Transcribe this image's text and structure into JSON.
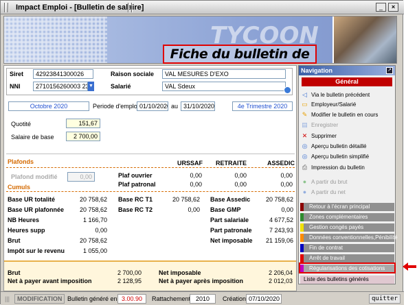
{
  "window": {
    "title": "Impact Emploi - [Bulletin de salaire]",
    "min": "_",
    "close": "×"
  },
  "banner": {
    "brand": "TYCOON",
    "heading": "Fiche du bulletin de salaire"
  },
  "form": {
    "siret_label": "Siret",
    "siret": "42923841300026",
    "raison_label": "Raison sociale",
    "raison": "VAL MESURES D'EXO",
    "nni_label": "NNI",
    "nni": "2710156260003 23",
    "salarie_label": "Salarié",
    "salarie": "VAL Sdeux"
  },
  "period": {
    "month": "Octobre 2020",
    "label": "Periode d'emploi",
    "from": "01/10/2020",
    "au": "au",
    "to": "31/10/2020",
    "quarter": "4e Trimestre  2020"
  },
  "quotite": {
    "label": "Quotité",
    "value": "151,67"
  },
  "base": {
    "label": "Salaire de base",
    "value": "2 700,00"
  },
  "plafonds": {
    "title": "Plafonds",
    "col1": "URSSAF",
    "col2": "RETRAITE",
    "col3": "ASSEDIC",
    "modif_label": "Plafond modifié",
    "modif_value": "0,00",
    "ouvrier": "Plaf ouvrier",
    "patronal": "Plaf patronal",
    "o1": "0,00",
    "o2": "0,00",
    "o3": "0,00",
    "p1": "0,00",
    "p2": "0,00",
    "p3": "0,00"
  },
  "cumuls": {
    "title": "Cumuls",
    "c1": [
      [
        "Base UR totalité",
        "20 758,62"
      ],
      [
        "Base UR plafonnée",
        "20 758,62"
      ],
      [
        "NB Heures",
        "1 166,70"
      ],
      [
        "Heures supp",
        "0,00"
      ],
      [
        "Brut",
        "20 758,62"
      ],
      [
        "Impôt sur le revenu",
        "1 055,00"
      ]
    ],
    "c2": [
      [
        "Base RC T1",
        "20 758,62"
      ],
      [
        "Base RC T2",
        "0,00"
      ]
    ],
    "c3": [
      [
        "Base Assedic",
        "20 758,62"
      ],
      [
        "Base GMP",
        "0,00"
      ],
      [
        "Part salariale",
        "4 677,52"
      ],
      [
        "Part patronale",
        "7 243,93"
      ],
      [
        "Net imposable",
        "21 159,06"
      ]
    ]
  },
  "totals": {
    "brut_label": "Brut",
    "brut": "2 700,00",
    "net_avant_label": "Net à payer avant imposition",
    "net_avant": "2 128,95",
    "netimp_label": "Net imposable",
    "netimp": "2 206,04",
    "net_apres_label": "Net à payer après imposition",
    "net_apres": "2 012,03"
  },
  "nav": {
    "title": "Navigation",
    "section": "Général",
    "items": [
      {
        "label": "Via le bulletin précédent",
        "icon": "doc-back-icon"
      },
      {
        "label": "Employeur/Salarié",
        "icon": "folder-icon"
      },
      {
        "label": "Modifier le bulletin en cours",
        "icon": "folder-edit-icon"
      },
      {
        "label": "Enregistrer",
        "icon": "save-icon"
      },
      {
        "label": "Supprimer",
        "icon": "delete-icon"
      },
      {
        "label": "Aperçu bulletin détaillé",
        "icon": "preview-icon"
      },
      {
        "label": "Aperçu bulletin simplifié",
        "icon": "preview-simple-icon"
      },
      {
        "label": "Impression du bulletin",
        "icon": "printer-icon"
      },
      {
        "label": "A partir du brut",
        "icon": "brut-icon"
      },
      {
        "label": "A partir du net",
        "icon": "net-icon"
      }
    ],
    "categories": [
      {
        "label": "Retour à l'écran principal",
        "color": "#8b0000"
      },
      {
        "label": "Zones complémentaires",
        "color": "#2e8b2e"
      },
      {
        "label": "Gestion congés payés",
        "color": "#f0e000"
      },
      {
        "label": "Données conventionnelles,Pénibilité",
        "color": "#ff8c00"
      },
      {
        "label": "Fin de contrat",
        "color": "#0000c0"
      },
      {
        "label": "Arrêt de travail",
        "color": "#e00000"
      },
      {
        "label": "Régularisations des cotisations",
        "color": "#c000c0"
      }
    ],
    "list_label": "Liste des bulletins générés"
  },
  "status": {
    "mode": "MODIFICATION",
    "gen_label": "Bulletin généré en",
    "version": "3.00.90",
    "ratt_label": "Rattachement",
    "ratt": "2010",
    "creation_label": "Création",
    "creation": "07/10/2020",
    "quit": "quitter"
  }
}
